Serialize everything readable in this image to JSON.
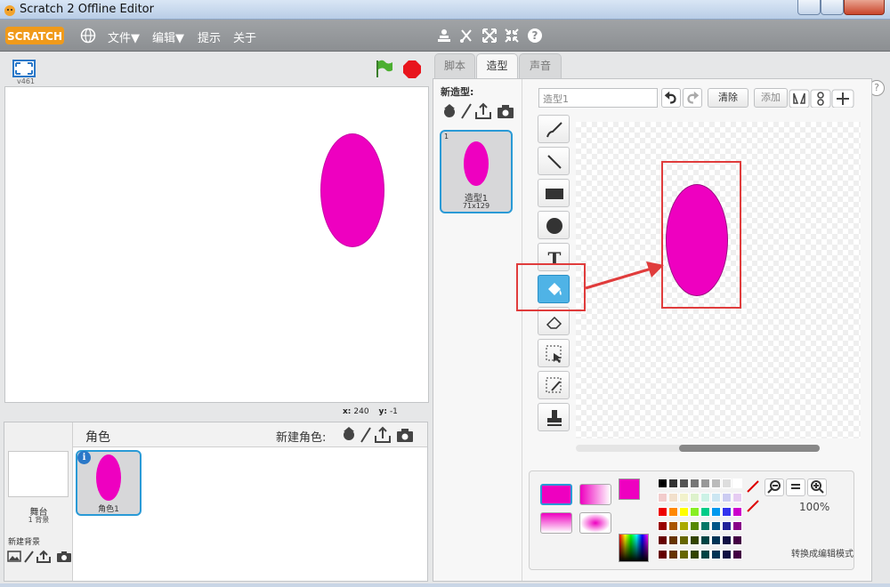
{
  "window": {
    "title": "Scratch 2 Offline Editor"
  },
  "menu": {
    "logo": "SCRATCH",
    "items": [
      "文件▼",
      "编辑▼",
      "提示",
      "关于"
    ]
  },
  "stage": {
    "version": "v461",
    "coords": {
      "x_label": "x:",
      "x": "240",
      "y_label": "y:",
      "y": "-1"
    }
  },
  "sprites": {
    "title": "角色",
    "new_sprite_label": "新建角色:",
    "stage_label": "舞台",
    "stage_sub": "1 背景",
    "new_bg_label": "新建背景",
    "items": [
      {
        "name": "角色1"
      }
    ]
  },
  "editor": {
    "tabs": [
      "脚本",
      "造型",
      "声音"
    ],
    "new_costume_label": "新造型:",
    "costume": {
      "number": "1",
      "name": "造型1",
      "size": "71x129"
    },
    "name_field": "造型1",
    "clear_label": "清除",
    "add_label": "添加",
    "zoom_pct": "100%",
    "mode_label": "转换成编辑模式",
    "help": "?"
  },
  "colors": {
    "sprite": "#ee00c0",
    "accent": "#2a9ad6",
    "annotation": "#e03c3c"
  }
}
